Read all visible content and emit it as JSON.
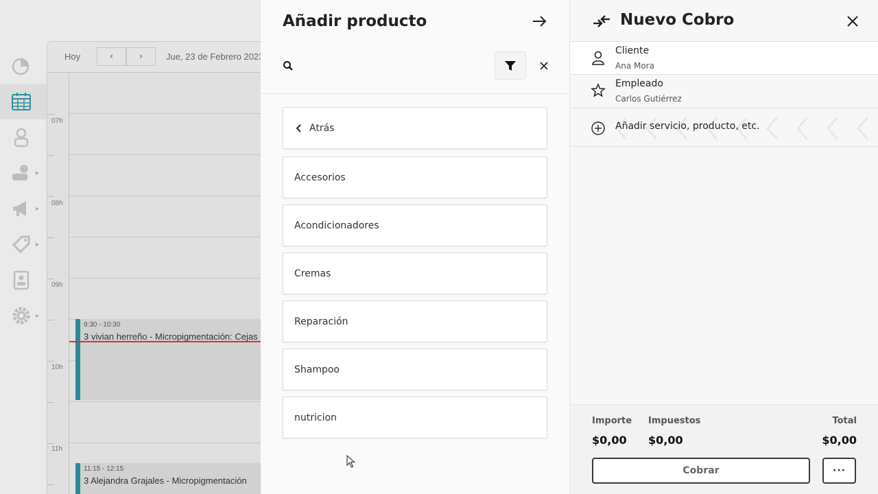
{
  "calendar": {
    "today_label": "Hoy",
    "prev_label": "‹",
    "next_label": "›",
    "date_label": "Jue, 23 de Febrero 2023",
    "hours": [
      "07h",
      "08h",
      "09h",
      "10h",
      "11h"
    ],
    "events": [
      {
        "time": "9:30 - 10:30",
        "title": "3 vivian herreño - Micropigmentación: Cejas"
      },
      {
        "time": "11:15 - 12:15",
        "title": "3 Alejandra Grajales - Micropigmentación"
      }
    ]
  },
  "sidebar": {
    "icons": [
      "chart-icon",
      "calendar-icon",
      "user-icon",
      "money-icon",
      "megaphone-icon",
      "tag-icon",
      "badge-icon",
      "gear-icon"
    ]
  },
  "add_product": {
    "title": "Añadir producto",
    "search_placeholder": "",
    "back_label": "Atrás",
    "categories": [
      "Accesorios",
      "Acondicionadores",
      "Cremas",
      "Reparación",
      "Shampoo",
      "nutricion"
    ]
  },
  "charge": {
    "title": "Nuevo Cobro",
    "client_label": "Cliente",
    "client_value": "Ana Mora",
    "employee_label": "Empleado",
    "employee_value": "Carlos Gutiérrez",
    "add_label": "Añadir servicio, producto, etc.",
    "amount_label": "Importe",
    "amount_value": "$0,00",
    "tax_label": "Impuestos",
    "tax_value": "$0,00",
    "total_label": "Total",
    "total_value": "$0,00",
    "pay_label": "Cobrar",
    "more_label": "···"
  }
}
